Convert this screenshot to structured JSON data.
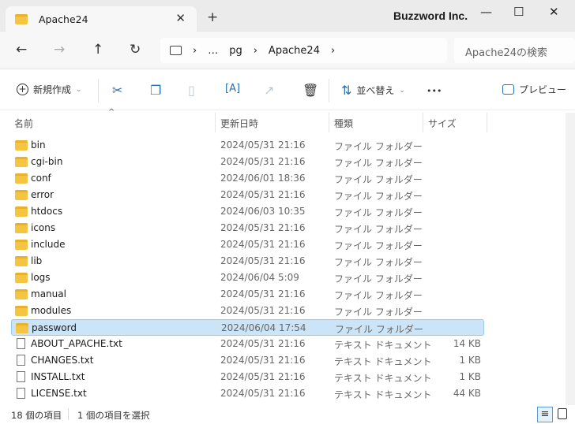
{
  "window": {
    "tab_title": "Apache24",
    "brand": "Buzzword Inc.",
    "tab_close": "✕",
    "new_tab": "+",
    "minimize": "—",
    "maximize": "☐",
    "close": "✕"
  },
  "nav": {
    "back": "←",
    "forward": "→",
    "up": "↑",
    "refresh": "↻",
    "breadcrumb": [
      "…",
      "pg",
      "Apache24"
    ],
    "sep": "›",
    "search_placeholder": "Apache24の検索"
  },
  "toolbar": {
    "new": "新規作成",
    "sort": "並べ替え",
    "more": "•••",
    "preview": "プレビュー"
  },
  "columns": {
    "name": "名前",
    "date": "更新日時",
    "type": "種類",
    "size": "サイズ"
  },
  "files": [
    {
      "name": "bin",
      "date": "2024/05/31 21:16",
      "type": "ファイル フォルダー",
      "size": "",
      "kind": "folder"
    },
    {
      "name": "cgi-bin",
      "date": "2024/05/31 21:16",
      "type": "ファイル フォルダー",
      "size": "",
      "kind": "folder"
    },
    {
      "name": "conf",
      "date": "2024/06/01 18:36",
      "type": "ファイル フォルダー",
      "size": "",
      "kind": "folder"
    },
    {
      "name": "error",
      "date": "2024/05/31 21:16",
      "type": "ファイル フォルダー",
      "size": "",
      "kind": "folder"
    },
    {
      "name": "htdocs",
      "date": "2024/06/03 10:35",
      "type": "ファイル フォルダー",
      "size": "",
      "kind": "folder"
    },
    {
      "name": "icons",
      "date": "2024/05/31 21:16",
      "type": "ファイル フォルダー",
      "size": "",
      "kind": "folder"
    },
    {
      "name": "include",
      "date": "2024/05/31 21:16",
      "type": "ファイル フォルダー",
      "size": "",
      "kind": "folder"
    },
    {
      "name": "lib",
      "date": "2024/05/31 21:16",
      "type": "ファイル フォルダー",
      "size": "",
      "kind": "folder"
    },
    {
      "name": "logs",
      "date": "2024/06/04 5:09",
      "type": "ファイル フォルダー",
      "size": "",
      "kind": "folder"
    },
    {
      "name": "manual",
      "date": "2024/05/31 21:16",
      "type": "ファイル フォルダー",
      "size": "",
      "kind": "folder"
    },
    {
      "name": "modules",
      "date": "2024/05/31 21:16",
      "type": "ファイル フォルダー",
      "size": "",
      "kind": "folder"
    },
    {
      "name": "password",
      "date": "2024/06/04 17:54",
      "type": "ファイル フォルダー",
      "size": "",
      "kind": "folder",
      "selected": true
    },
    {
      "name": "ABOUT_APACHE.txt",
      "date": "2024/05/31 21:16",
      "type": "テキスト ドキュメント",
      "size": "14 KB",
      "kind": "file"
    },
    {
      "name": "CHANGES.txt",
      "date": "2024/05/31 21:16",
      "type": "テキスト ドキュメント",
      "size": "1 KB",
      "kind": "file"
    },
    {
      "name": "INSTALL.txt",
      "date": "2024/05/31 21:16",
      "type": "テキスト ドキュメント",
      "size": "1 KB",
      "kind": "file"
    },
    {
      "name": "LICENSE.txt",
      "date": "2024/05/31 21:16",
      "type": "テキスト ドキュメント",
      "size": "44 KB",
      "kind": "file"
    }
  ],
  "status": {
    "count": "18 個の項目",
    "selected": "1 個の項目を選択"
  }
}
